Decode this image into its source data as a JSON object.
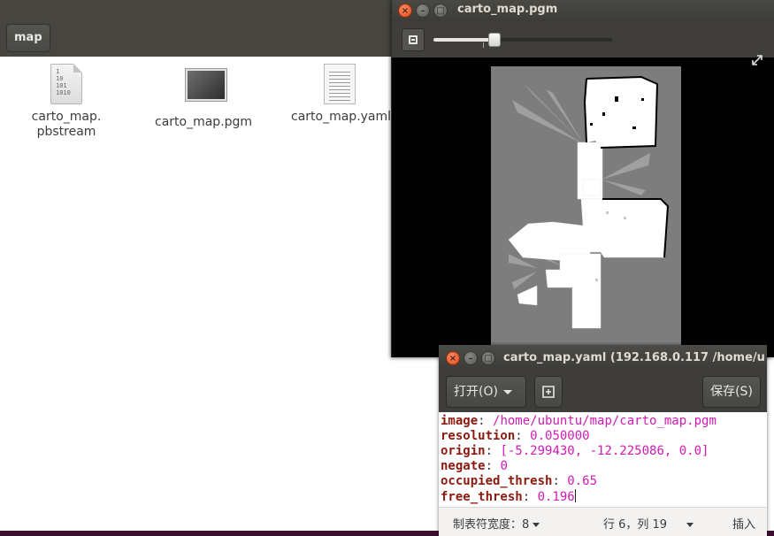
{
  "file_manager": {
    "path_button": "map",
    "files": [
      {
        "name_line1": "carto_map.",
        "name_line2": "pbstream",
        "icon": "binary-file-icon"
      },
      {
        "name_line1": "carto_map.pgm",
        "name_line2": "",
        "icon": "image-file-icon"
      },
      {
        "name_line1": "carto_map.yaml",
        "name_line2": "",
        "icon": "text-file-icon"
      }
    ]
  },
  "image_viewer": {
    "title": "carto_map.pgm",
    "zoom_level": 0.34,
    "buttons": {
      "close": "×",
      "minimize": "–",
      "maximize": "□"
    }
  },
  "text_editor": {
    "title": "carto_map.yaml (192.168.0.117 /home/u",
    "open_label": "打开(O)",
    "save_label": "保存(S)",
    "lines": [
      {
        "key": "image",
        "value": "/home/ubuntu/map/carto_map.pgm"
      },
      {
        "key": "resolution",
        "value": "0.050000"
      },
      {
        "key": "origin",
        "value": "[-5.299430, -12.225086, 0.0]"
      },
      {
        "key": "negate",
        "value": "0"
      },
      {
        "key": "occupied_thresh",
        "value": "0.65"
      },
      {
        "key": "free_thresh",
        "value": "0.196"
      }
    ],
    "status": {
      "tab_width": "制表符宽度：8",
      "position": "行 6，列 19",
      "mode": "插入"
    }
  }
}
